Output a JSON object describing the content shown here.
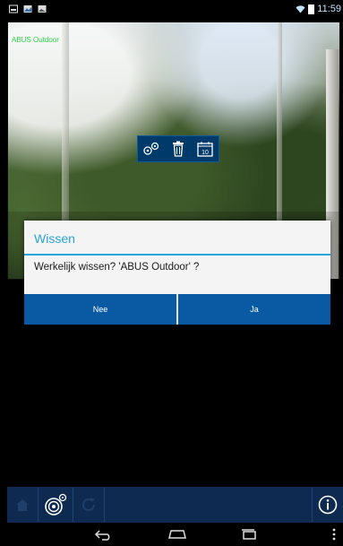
{
  "status_bar": {
    "time": "11:59",
    "left_icons": [
      "image-icon",
      "photo-icon",
      "photo-icon"
    ],
    "right_icons": [
      "wifi-icon",
      "battery-icon"
    ]
  },
  "camera": {
    "name_overlay": "ABUS Outdoor"
  },
  "camera_toolbar": {
    "icons": [
      "gears-icon",
      "trash-icon",
      "calendar-icon"
    ],
    "calendar_day": "10"
  },
  "dialog": {
    "title": "Wissen",
    "message": "Werkelijk wissen? 'ABUS Outdoor' ?",
    "no_label": "Nee",
    "yes_label": "Ja"
  },
  "bottom_toolbar": {
    "icons": [
      "home-icon",
      "camera-settings-icon",
      "refresh-icon",
      "info-icon"
    ]
  },
  "navigation": {
    "icons": [
      "back-icon",
      "home-icon",
      "recent-apps-icon",
      "overflow-menu-icon"
    ]
  },
  "colors": {
    "dialog_accent": "#2aa3d8",
    "button_blue": "#0a5aa3",
    "toolbar_blue": "#0e2a50"
  }
}
